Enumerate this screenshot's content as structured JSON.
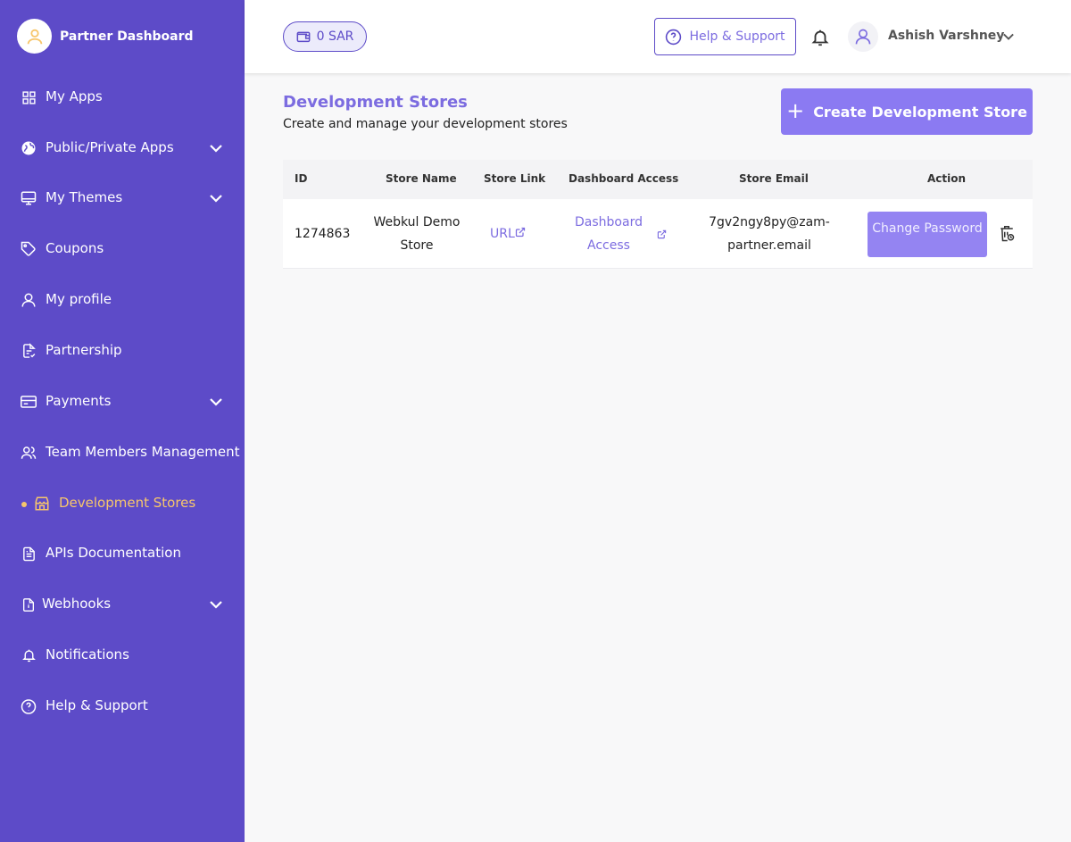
{
  "sidebar": {
    "brand_title": "Partner Dashboard",
    "items": [
      {
        "label": "My Apps",
        "icon": "grid-icon"
      },
      {
        "label": "Public/Private Apps",
        "icon": "globe-icon"
      },
      {
        "label": "My Themes",
        "icon": "monitor-icon"
      },
      {
        "label": "Coupons",
        "icon": "tag-icon"
      },
      {
        "label": "My profile",
        "icon": "user-icon"
      },
      {
        "label": "Partnership",
        "icon": "document-check-icon"
      },
      {
        "label": "Payments",
        "icon": "credit-card-icon"
      },
      {
        "label": "Team Members Management",
        "icon": "users-icon"
      },
      {
        "label": "Development Stores",
        "icon": "store-icon"
      },
      {
        "label": "APIs Documentation",
        "icon": "document-icon"
      },
      {
        "label": "Webhooks",
        "icon": "file-icon"
      },
      {
        "label": "Notifications",
        "icon": "bell-icon"
      },
      {
        "label": "Help & Support",
        "icon": "question-circle-icon"
      }
    ],
    "active": "Development Stores"
  },
  "header": {
    "wallet_balance": "0 SAR",
    "help_label": "Help & Support",
    "user_name": "Ashish Varshney"
  },
  "main": {
    "title": "Development Stores",
    "subtitle": "Create and manage your development stores",
    "create_button": "Create Development Store",
    "table": {
      "columns": [
        "ID",
        "Store Name",
        "Store Link",
        "Dashboard Access",
        "Store Email",
        "Action"
      ],
      "rows": [
        {
          "id": "1274863",
          "store_name": "Webkul Demo Store",
          "store_link": "URL",
          "dashboard_access": "Dashboard Access",
          "store_email": "7gv2ngy8py@zam-partner.email",
          "action": "Change Password"
        }
      ]
    }
  },
  "colors": {
    "sidebar_bg": "#5d4bc8",
    "accent": "#7c6ce0",
    "active_item": "#f7c66b",
    "button_bg": "#8b7af2"
  }
}
